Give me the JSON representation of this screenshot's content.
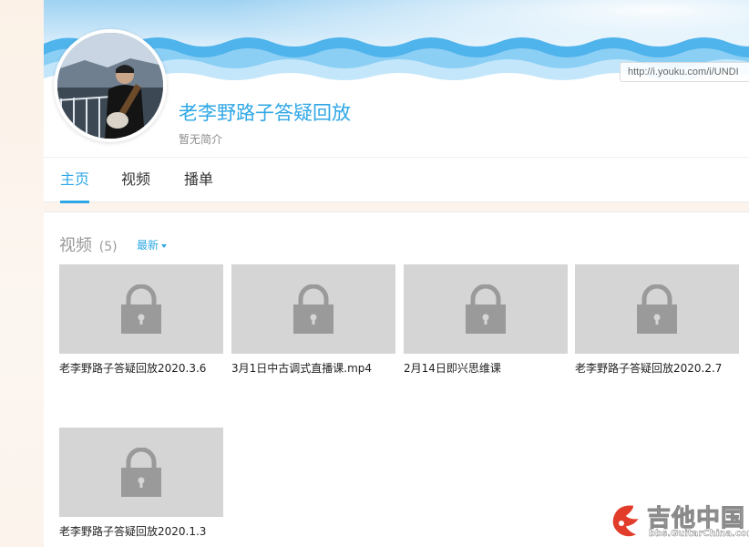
{
  "header": {
    "url": "http://i.youku.com/i/UNDI",
    "channel_name": "老李野路子答疑回放",
    "bio": "暂无简介"
  },
  "tabs": [
    {
      "label": "主页",
      "active": true
    },
    {
      "label": "视频",
      "active": false
    },
    {
      "label": "播单",
      "active": false
    }
  ],
  "videos_section": {
    "title": "视频",
    "count": "(5)",
    "sort_label": "最新"
  },
  "videos": [
    {
      "title": "老李野路子答疑回放2020.3.6",
      "thumbnail_icon": "lock-icon"
    },
    {
      "title": "3月1日中古调式直播课.mp4",
      "thumbnail_icon": "lock-icon"
    },
    {
      "title": "2月14日即兴思维课",
      "thumbnail_icon": "lock-icon"
    },
    {
      "title": "老李野路子答疑回放2020.2.7",
      "thumbnail_icon": "lock-icon"
    },
    {
      "title": "老李野路子答疑回放2020.1.3",
      "thumbnail_icon": "lock-icon"
    }
  ],
  "watermark": {
    "cn": "吉他中国",
    "en": "bbs.GuitarChina.com"
  },
  "colors": {
    "accent": "#2fa7e6",
    "thumb_bg": "#d5d5d5",
    "lock": "#9a9a9a"
  }
}
